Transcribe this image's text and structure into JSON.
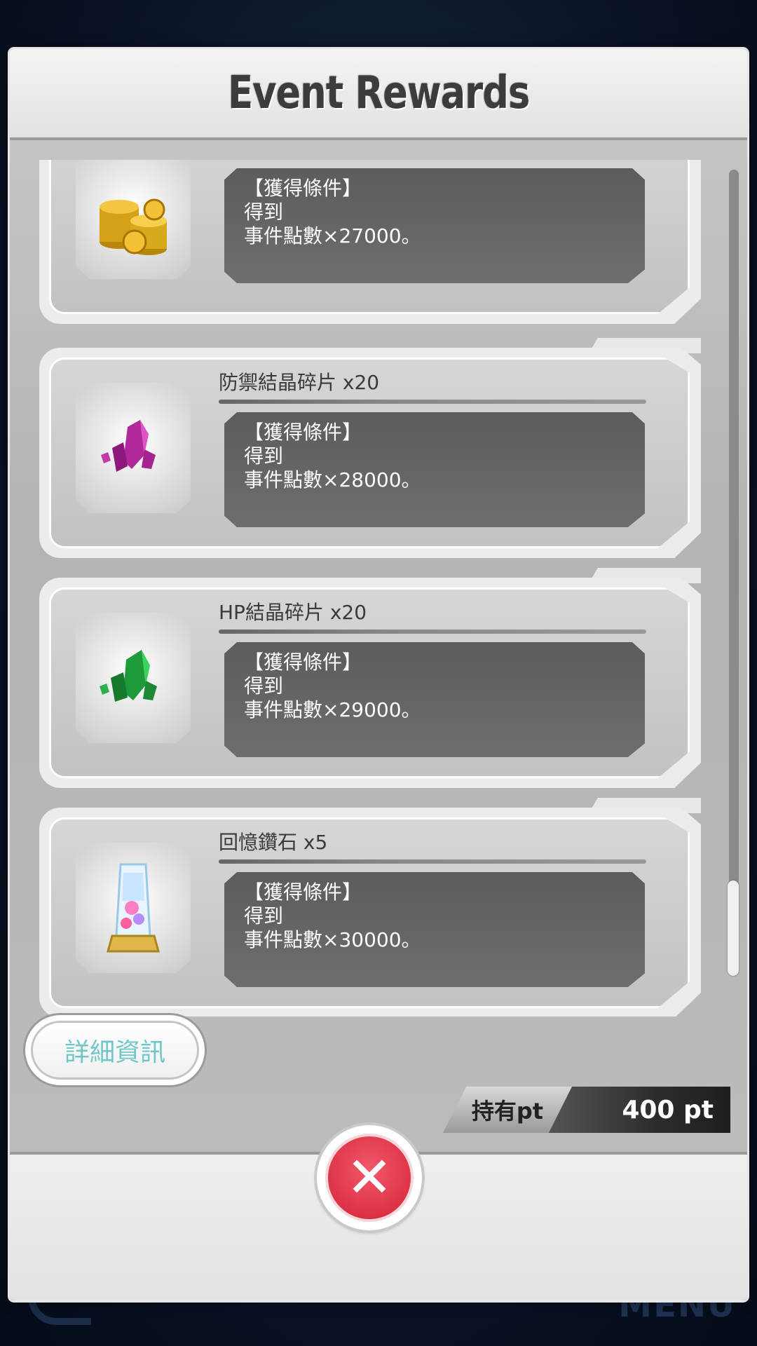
{
  "background": {
    "menu_label": "MENU"
  },
  "dialog": {
    "title": "Event Rewards",
    "rewards": [
      {
        "name": "",
        "icon": "gold-coins-icon",
        "condition_header": "【獲得條件】",
        "condition_line1": "得到",
        "condition_line2": "事件點數×27000。"
      },
      {
        "name": "防禦結晶碎片 x20",
        "icon": "purple-crystal-shards-icon",
        "condition_header": "【獲得條件】",
        "condition_line1": "得到",
        "condition_line2": "事件點數×28000。"
      },
      {
        "name": "HP結晶碎片 x20",
        "icon": "green-crystal-shards-icon",
        "condition_header": "【獲得條件】",
        "condition_line1": "得到",
        "condition_line2": "事件點數×29000。"
      },
      {
        "name": "回憶鑽石 x5",
        "icon": "memory-diamond-icon",
        "condition_header": "【獲得條件】",
        "condition_line1": "得到",
        "condition_line2": "事件點數×30000。"
      }
    ],
    "detail_button_label": "詳細資訊",
    "points_label": "持有pt",
    "points_value": "400 pt",
    "close_button_symbol": "✕",
    "colors": {
      "close_button": "#dd3346",
      "detail_text": "#6fc7c9",
      "condition_box": "#636363"
    }
  }
}
